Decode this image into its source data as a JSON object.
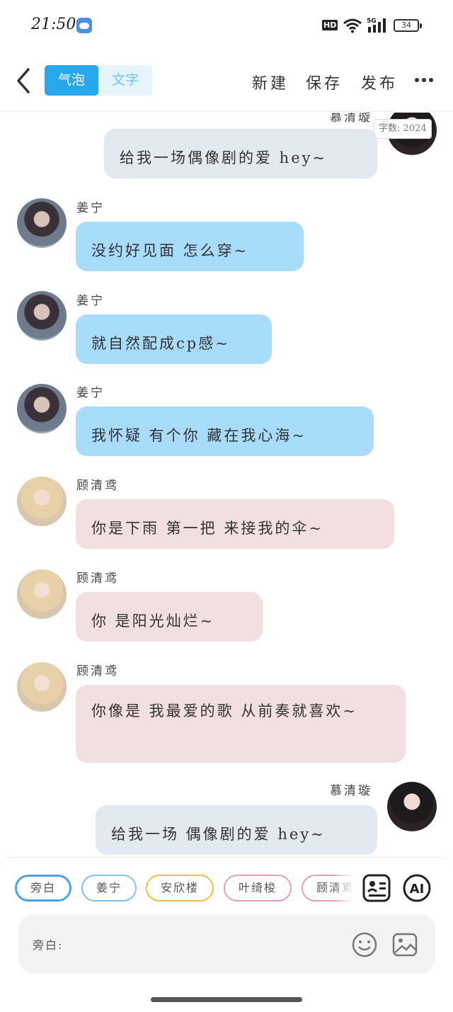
{
  "status_bar": {
    "time": "21:50",
    "hd_badge": "HD",
    "network": "5G",
    "battery": "34"
  },
  "top_bar": {
    "modes": [
      "气泡",
      "文字"
    ],
    "actions": {
      "new": "新建",
      "save": "保存",
      "publish": "发布"
    }
  },
  "chat": {
    "word_count": "字数: 2024",
    "top_partial_name": "慕清璇",
    "messages": [
      {
        "text": "给我一场偶像剧的爱 hey~"
      },
      {
        "name": "姜宁",
        "text": "没约好见面 怎么穿~"
      },
      {
        "name": "姜宁",
        "text": "就自然配成cp感~"
      },
      {
        "name": "姜宁",
        "text": "我怀疑 有个你 藏在我心海~"
      },
      {
        "name": "顾清鸢",
        "text": "你是下雨 第一把 来接我的伞~"
      },
      {
        "name": "顾清鸢",
        "text": "你 是阳光灿烂~"
      },
      {
        "name": "顾清鸢",
        "text": "你像是 我最爱的歌 从前奏就喜欢~"
      },
      {
        "name": "慕清璇",
        "text": "给我一场 偶像剧的爱 hey~"
      }
    ]
  },
  "bottom": {
    "chips": [
      {
        "label": "旁白",
        "color": "#4aa3e6"
      },
      {
        "label": "姜宁",
        "color": "#7cc4ea"
      },
      {
        "label": "安欣楼",
        "color": "#e9c23a"
      },
      {
        "label": "叶绮梭",
        "color": "#e6a0b3"
      },
      {
        "label": "顾清鸢",
        "color": "#e6a0b3"
      }
    ],
    "ai_label": "AI",
    "input_label": "旁白:"
  },
  "colors": {
    "accent": "#27a7ec",
    "bubble_blue": "#a8dcfb",
    "bubble_pink": "#f2dfe2",
    "bubble_gray": "#e3e9f1"
  }
}
